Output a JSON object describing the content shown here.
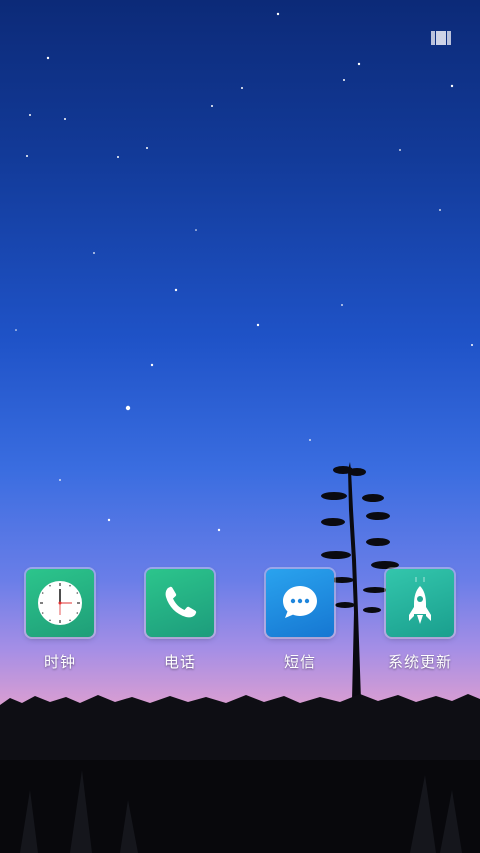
{
  "screen": {
    "type": "home-screen",
    "wallpaper": "night-sky-with-tree-silhouette"
  },
  "status": {
    "edit_badge_icon": "grid-icon"
  },
  "apps": [
    {
      "label": "时钟",
      "icon": "clock-icon"
    },
    {
      "label": "电话",
      "icon": "phone-icon"
    },
    {
      "label": "短信",
      "icon": "message-bubble-icon"
    },
    {
      "label": "系统更新",
      "icon": "rocket-icon"
    }
  ],
  "colors": {
    "label_text": "#ffffff",
    "clock_green": "#2cc58c",
    "phone_green": "#2cc58c",
    "sms_blue": "#2aa3ee",
    "update_teal": "#33c6ac"
  }
}
